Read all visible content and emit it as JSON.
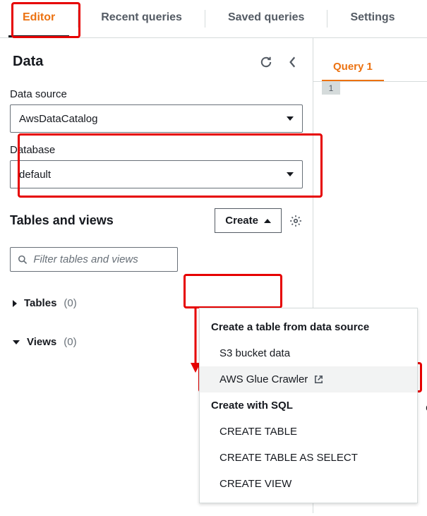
{
  "topnav": {
    "tabs": [
      "Editor",
      "Recent queries",
      "Saved queries",
      "Settings"
    ],
    "active_index": 0
  },
  "left": {
    "title": "Data",
    "data_source": {
      "label": "Data source",
      "value": "AwsDataCatalog"
    },
    "database": {
      "label": "Database",
      "value": "default"
    },
    "tables_views": {
      "title": "Tables and views",
      "create_label": "Create",
      "filter_placeholder": "Filter tables and views",
      "tables": {
        "label": "Tables",
        "count": "(0)"
      },
      "views": {
        "label": "Views",
        "count": "(0)"
      }
    },
    "create_menu": {
      "section1_header": "Create a table from data source",
      "section1_items": [
        "S3 bucket data",
        "AWS Glue Crawler"
      ],
      "section2_header": "Create with SQL",
      "section2_items": [
        "CREATE TABLE",
        "CREATE TABLE AS SELECT",
        "CREATE VIEW"
      ]
    }
  },
  "right": {
    "tab_label": "Query 1",
    "linenum": "1",
    "edge_text": "C"
  }
}
